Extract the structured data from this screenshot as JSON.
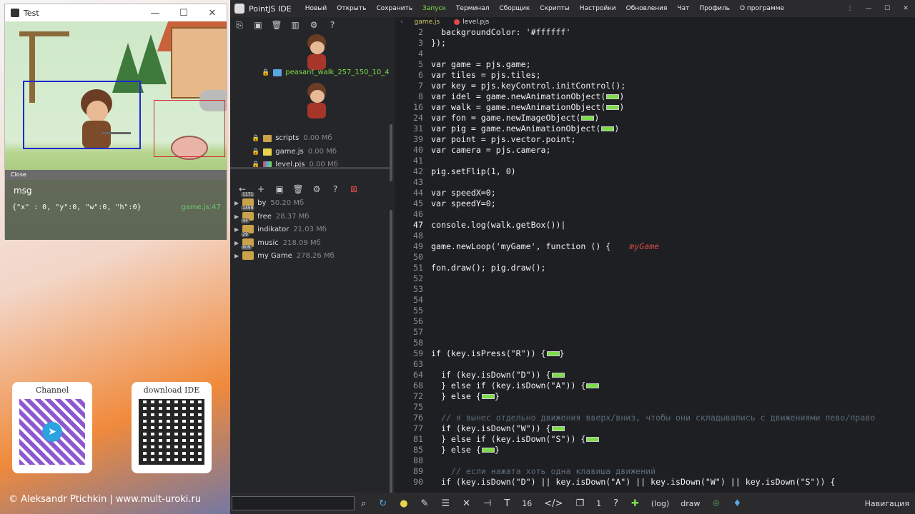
{
  "test_window": {
    "title": "Test",
    "close_label": "Close",
    "msg_title": "msg",
    "msg_text": "{\"x\" : 0, \"y\":0, \"w\":0, \"h\":0}",
    "msg_file": "game.js:47"
  },
  "qr": {
    "channel_label": "Channel",
    "download_label": "download IDE"
  },
  "copyright": "© Aleksandr Ptichkin | www.mult-uroki.ru",
  "ide": {
    "title": "PointJS IDE",
    "menu": [
      "Новый",
      "Открыть",
      "Сохранить",
      "Запуск",
      "Терминал",
      "Сборщик",
      "Скрипты",
      "Настройки",
      "Обновления",
      "Чат",
      "Профиль",
      "О программе"
    ],
    "window_controls": [
      "⋮",
      "—",
      "☐",
      "✕"
    ]
  },
  "sidebar": {
    "asset_name": "peasant_walk_257_150_10_4",
    "files": [
      {
        "name": "scripts",
        "size": "0.00 Мб"
      },
      {
        "name": "game.js",
        "size": "0.00 Мб"
      },
      {
        "name": "level.pjs",
        "size": "0.00 Мб"
      }
    ],
    "folders": [
      {
        "name": "by",
        "size": "50.20 Мб",
        "badge": "1171"
      },
      {
        "name": "free",
        "size": "28.37 Мб",
        "badge": "1459"
      },
      {
        "name": "indikator",
        "size": "21.03 Мб",
        "badge": "44"
      },
      {
        "name": "music",
        "size": "218.09 Мб",
        "badge": "29"
      },
      {
        "name": "my Game",
        "size": "278.26 Мб",
        "badge": "809"
      }
    ]
  },
  "editor": {
    "tabs": [
      "game.js",
      "level.pjs"
    ],
    "lines": [
      {
        "n": "2",
        "code": "  backgroundColor: '#ffffff'"
      },
      {
        "n": "3",
        "code": "});"
      },
      {
        "n": "4",
        "code": ""
      },
      {
        "n": "5",
        "code": "var game = pjs.game;"
      },
      {
        "n": "6",
        "code": "var tiles = pjs.tiles;"
      },
      {
        "n": "7",
        "code": "var key = pjs.keyControl.initControl();"
      },
      {
        "n": "8",
        "code": "var idel = game.newAnimationObject(",
        "mark": true,
        "tail": ")"
      },
      {
        "n": "16",
        "code": "var walk = game.newAnimationObject(",
        "mark": true,
        "tail": ")"
      },
      {
        "n": "24",
        "code": "var fon = game.newImageObject(",
        "mark": true,
        "tail": ")"
      },
      {
        "n": "31",
        "code": "var pig = game.newAnimationObject(",
        "mark": true,
        "tail": ")"
      },
      {
        "n": "39",
        "code": "var point = pjs.vector.point;"
      },
      {
        "n": "40",
        "code": "var camera = pjs.camera;"
      },
      {
        "n": "41",
        "code": ""
      },
      {
        "n": "42",
        "code": "pig.setFlip(1, 0)"
      },
      {
        "n": "43",
        "code": ""
      },
      {
        "n": "44",
        "code": "var speedX=0;"
      },
      {
        "n": "45",
        "code": "var speedY=0;"
      },
      {
        "n": "46",
        "code": ""
      },
      {
        "n": "47",
        "code": "console.log(walk.getBox())|"
      },
      {
        "n": "48",
        "code": ""
      },
      {
        "n": "49",
        "code": "game.newLoop('myGame', function () {",
        "note": "myGame"
      },
      {
        "n": "50",
        "code": ""
      },
      {
        "n": "51",
        "code": "fon.draw(); pig.draw();"
      },
      {
        "n": "52",
        "code": ""
      },
      {
        "n": "53",
        "code": ""
      },
      {
        "n": "54",
        "code": ""
      },
      {
        "n": "55",
        "code": ""
      },
      {
        "n": "56",
        "code": ""
      },
      {
        "n": "57",
        "code": ""
      },
      {
        "n": "58",
        "code": ""
      },
      {
        "n": "59",
        "code": "if (key.isPress(\"R\")) {",
        "mark": true,
        "tail": "}"
      },
      {
        "n": "63",
        "code": ""
      },
      {
        "n": "64",
        "code": "  if (key.isDown(\"D\")) {",
        "mark": true,
        "tail": ""
      },
      {
        "n": "68",
        "code": "  } else if (key.isDown(\"A\")) {",
        "mark": true,
        "tail": ""
      },
      {
        "n": "72",
        "code": "  } else {",
        "mark": true,
        "tail": "}"
      },
      {
        "n": "75",
        "code": ""
      },
      {
        "n": "76",
        "code": "  // я вынес отдельно движения вверх/вниз, чтобы они складывались с движениями лево/право",
        "comment": true
      },
      {
        "n": "77",
        "code": "  if (key.isDown(\"W\")) {",
        "mark": true,
        "tail": ""
      },
      {
        "n": "81",
        "code": "  } else if (key.isDown(\"S\")) {",
        "mark": true,
        "tail": ""
      },
      {
        "n": "85",
        "code": "  } else {",
        "mark": true,
        "tail": "}"
      },
      {
        "n": "88",
        "code": ""
      },
      {
        "n": "89",
        "code": "    // если нажата хоть одна клавиша движений",
        "comment": true
      },
      {
        "n": "90",
        "code": "  if (key.isDown(\"D\") || key.isDown(\"A\") || key.isDown(\"W\") || key.isDown(\"S\")) {"
      }
    ]
  },
  "bottombar": {
    "font_size": "16",
    "tab_count": "1",
    "log_label": "(log)",
    "draw_label": "draw",
    "nav_label": "Навигация"
  }
}
